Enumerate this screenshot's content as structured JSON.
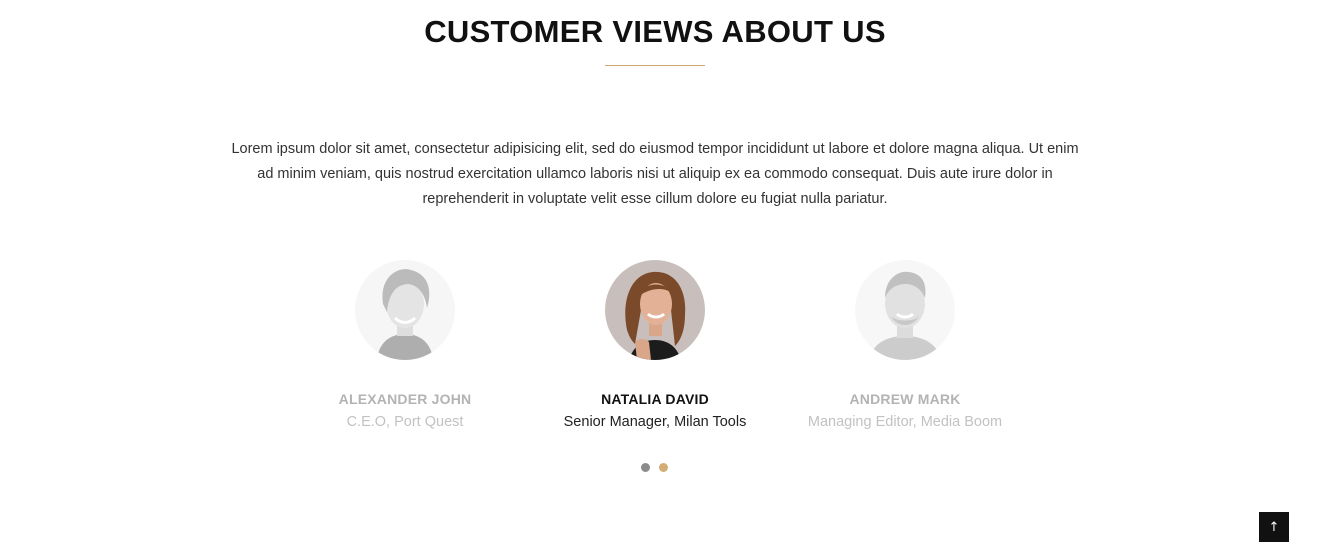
{
  "section": {
    "title": "CUSTOMER VIEWS ABOUT US",
    "intro": "Lorem ipsum dolor sit amet, consectetur adipisicing elit, sed do eiusmod tempor incididunt ut labore et dolore magna aliqua. Ut enim ad minim veniam, quis nostrud exercitation ullamco laboris nisi ut aliquip ex ea commodo consequat. Duis aute irure dolor in reprehenderit in voluptate velit esse cillum dolore eu fugiat nulla pariatur.",
    "accent_color": "#c9a96e"
  },
  "testimonials": [
    {
      "name": "ALEXANDER JOHN",
      "role": "C.E.O, Port Quest",
      "active": false
    },
    {
      "name": "NATALIA DAVID",
      "role": "Senior Manager, Milan Tools",
      "active": true
    },
    {
      "name": "ANDREW MARK",
      "role": "Managing Editor, Media Boom",
      "active": false
    }
  ],
  "carousel": {
    "dot_count": 2,
    "active_dot": 2,
    "dot_colors": [
      "#8c8c8c",
      "#d3ad74"
    ]
  },
  "back_to_top": {
    "icon": "arrow-up-icon",
    "glyph": "↑"
  }
}
